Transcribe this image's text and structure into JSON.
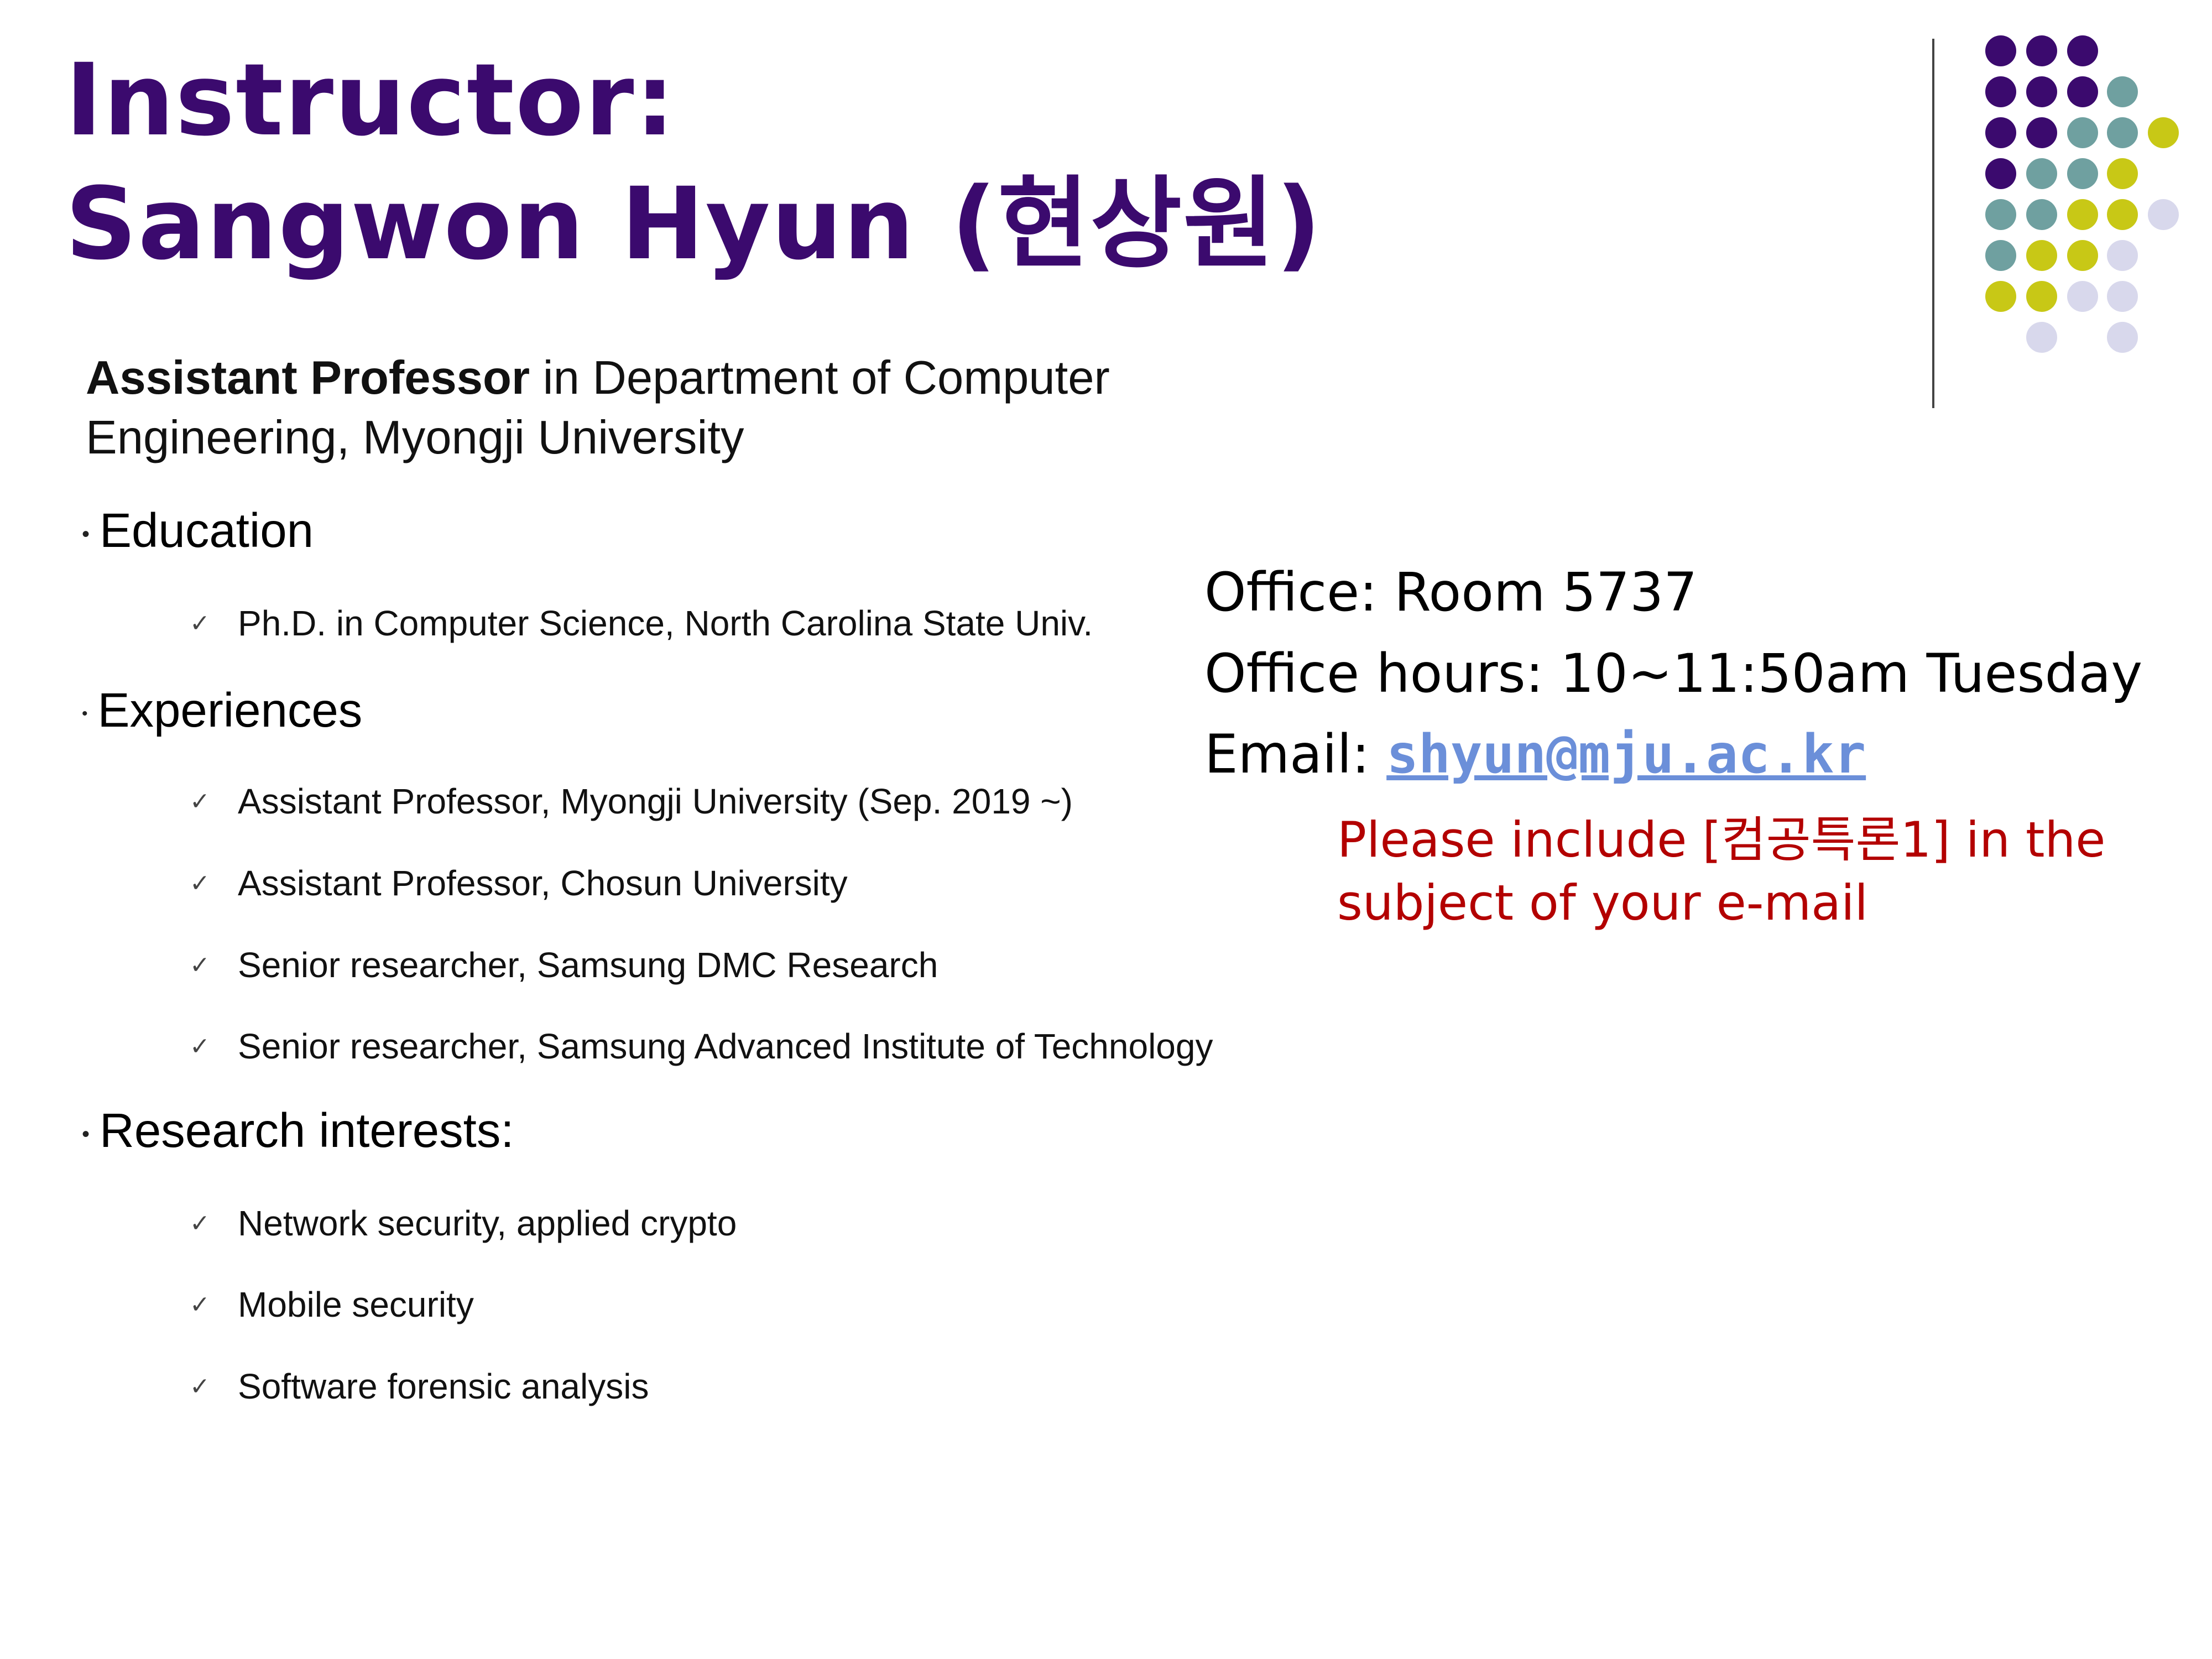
{
  "title": {
    "line1": "Instructor:",
    "line2": "Sangwon Hyun (현상원)"
  },
  "role": {
    "bold": "Assistant Professor",
    "rest": " in Department of Computer Engineering, Myongji University"
  },
  "sections": [
    {
      "heading": "Education",
      "items": [
        "Ph.D. in Computer Science, North Carolina State Univ."
      ]
    },
    {
      "heading": "Experiences",
      "items": [
        "Assistant Professor, Myongji University (Sep. 2019 ~)",
        "Assistant Professor, Chosun University",
        "Senior researcher, Samsung DMC Research",
        "Senior researcher, Samsung Advanced Institute of Technology"
      ]
    },
    {
      "heading": "Research interests:",
      "items": [
        "Network security, applied crypto",
        "Mobile security",
        "Software forensic analysis"
      ]
    }
  ],
  "contact": {
    "office": "Office: Room 5737",
    "hours": "Office hours: 10~11:50am Tuesday",
    "email_label": "Email: ",
    "email": "shyun@mju.ac.kr",
    "note_line1": "Please include [컴공특론1] in the",
    "note_line2": " subject of your e-mail"
  },
  "colors": {
    "title": "#3b0a6e",
    "note": "#b30000",
    "link": "#6b8fd9",
    "dot_purple": "#3b0a6e",
    "dot_teal": "#6fa0a0",
    "dot_yellow": "#c8c816",
    "dot_lavender": "#d8d8ec"
  }
}
